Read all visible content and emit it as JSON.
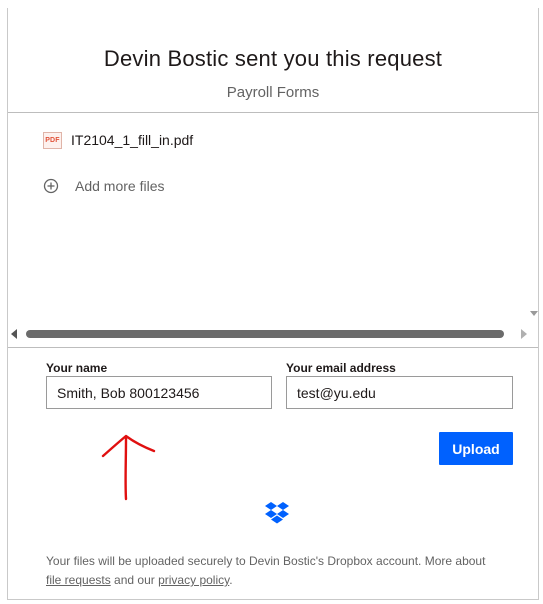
{
  "header": {
    "title": "Devin Bostic sent you this request",
    "subtitle": "Payroll Forms"
  },
  "files": [
    {
      "badge": "PDF",
      "name": "IT2104_1_fill_in.pdf"
    }
  ],
  "add_files_label": "Add more files",
  "form": {
    "name_label": "Your name",
    "name_value": "Smith, Bob 800123456",
    "email_label": "Your email address",
    "email_value": "test@yu.edu",
    "upload_label": "Upload"
  },
  "footer": {
    "text_before": "Your files will be uploaded securely to Devin Bostic's Dropbox account. More about",
    "link1": "file requests",
    "text_middle": "and our",
    "link2": "privacy policy",
    "text_after": "."
  },
  "colors": {
    "upload_button": "#0061fe",
    "dropbox_logo": "#0061fe",
    "annotation_arrow": "#e01010"
  }
}
